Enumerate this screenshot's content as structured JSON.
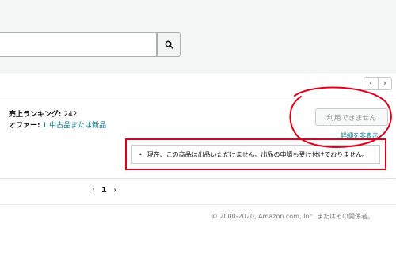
{
  "search": {
    "value": "",
    "button_icon": "search-icon"
  },
  "pager": {
    "prev": "‹",
    "next": "›"
  },
  "product": {
    "rank_label": "売上ランキング:",
    "rank_value": "242",
    "offers_label": "オファー:",
    "offers_link": "1 中古品または新品"
  },
  "action_button": "利用できません",
  "details_toggle": "詳細を非表示 ^",
  "notice": {
    "bullet": "•",
    "text": "現在、この商品は出品いただけません。出品の申請も受け付けておりません。"
  },
  "pagination": {
    "prev": "‹",
    "page": "1",
    "next": "›"
  },
  "footer": {
    "copyright": "© 2000-2020, Amazon.com, Inc. またはその関係者。"
  },
  "colors": {
    "annotation": "#e0001a",
    "link": "#007185"
  }
}
